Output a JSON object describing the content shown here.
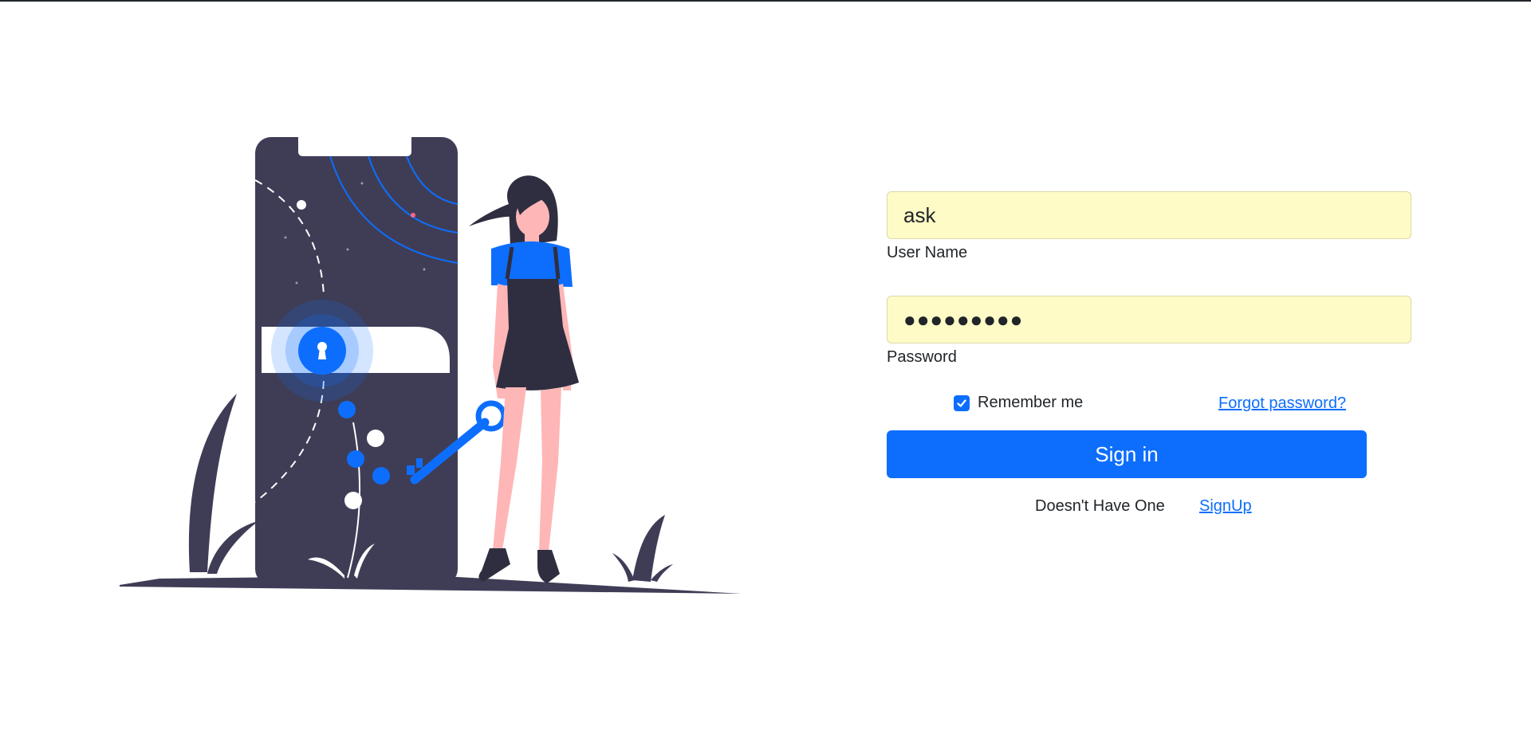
{
  "login_form": {
    "username": {
      "value": "ask",
      "label": "User Name"
    },
    "password": {
      "masked_value": "●●●●●●●●●",
      "label": "Password"
    },
    "remember_me": {
      "label": "Remember me",
      "checked": true
    },
    "forgot_password_label": "Forgot password?",
    "sign_in_label": "Sign in",
    "no_account_text": "Doesn't Have One",
    "signup_label": "SignUp"
  },
  "colors": {
    "primary": "#0d6efd",
    "autofill_background": "#fefbc6",
    "illustration_dark": "#3f3d56",
    "skin": "#ffb6b6",
    "figure_dark": "#2f2e41"
  },
  "illustration": {
    "icon": "keyhole-icon"
  }
}
